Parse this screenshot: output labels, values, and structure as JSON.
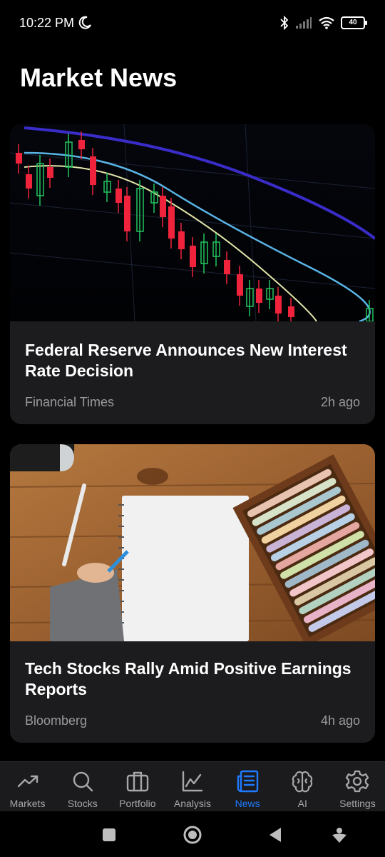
{
  "status_bar": {
    "time": "10:22 PM",
    "battery": "40"
  },
  "header": {
    "title": "Market News"
  },
  "articles": [
    {
      "title": "Federal Reserve Announces New Interest Rate Decision",
      "source": "Financial Times",
      "time": "2h ago",
      "image": "candlestick-chart-image"
    },
    {
      "title": "Tech Stocks Rally Amid Positive Earnings Reports",
      "source": "Bloomberg",
      "time": "4h ago",
      "image": "notebook-pastels-desk-image"
    }
  ],
  "nav": {
    "items": [
      {
        "label": "Markets",
        "icon": "trending-up-icon"
      },
      {
        "label": "Stocks",
        "icon": "search-icon"
      },
      {
        "label": "Portfolio",
        "icon": "briefcase-icon"
      },
      {
        "label": "Analysis",
        "icon": "line-chart-icon"
      },
      {
        "label": "News",
        "icon": "newspaper-icon"
      },
      {
        "label": "AI",
        "icon": "brain-icon"
      },
      {
        "label": "Settings",
        "icon": "gear-icon"
      }
    ],
    "active": "News"
  },
  "colors": {
    "accent": "#1e7bff",
    "card_bg": "#1c1c1e",
    "nav_bg": "#1b1b1d",
    "muted_text": "#9a9a9f",
    "candle_up": "#22c55e",
    "candle_down": "#ef233c"
  }
}
